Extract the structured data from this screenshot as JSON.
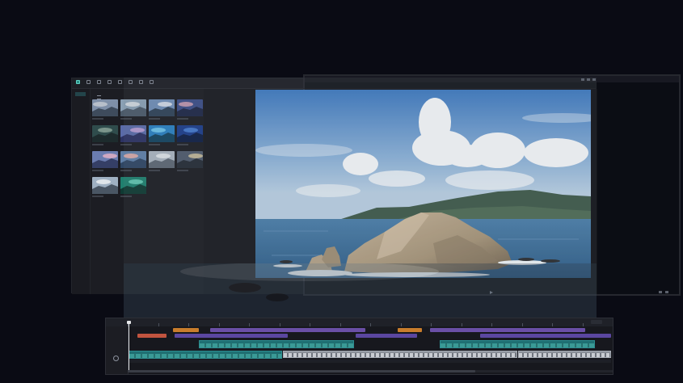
{
  "app": {
    "accent": "#5fd3c5",
    "background": "#0a0b14"
  },
  "editor": {
    "toolbar": [
      {
        "name": "media",
        "icon": "media-icon",
        "active": true
      },
      {
        "name": "audio",
        "icon": "audio-icon"
      },
      {
        "name": "text",
        "icon": "text-icon"
      },
      {
        "name": "stickers",
        "icon": "sticker-icon"
      },
      {
        "name": "effects",
        "icon": "effects-icon"
      },
      {
        "name": "transitions",
        "icon": "transition-icon"
      },
      {
        "name": "filters",
        "icon": "filter-icon"
      },
      {
        "name": "adjust",
        "icon": "adjust-icon"
      }
    ],
    "media_thumbnails": [
      {
        "palette": [
          "#7e8fa8",
          "#c6cbd2",
          "#3e4b5c"
        ]
      },
      {
        "palette": [
          "#8aa0b4",
          "#dfe3e7",
          "#4b5a69"
        ]
      },
      {
        "palette": [
          "#6f8db5",
          "#e6e9ee",
          "#2f4257"
        ]
      },
      {
        "palette": [
          "#3c4d86",
          "#d9a6b5",
          "#1f2747"
        ]
      },
      {
        "palette": [
          "#2f4c4c",
          "#8fa89b",
          "#1d2b2d"
        ]
      },
      {
        "palette": [
          "#5a6aa8",
          "#c7a6d9",
          "#2c3263"
        ]
      },
      {
        "palette": [
          "#2a7fc0",
          "#7ad0f0",
          "#14435f"
        ]
      },
      {
        "palette": [
          "#1c3d8a",
          "#4d86d8",
          "#0f1f45"
        ]
      },
      {
        "palette": [
          "#6b7db0",
          "#e9b3c7",
          "#353f66"
        ]
      },
      {
        "palette": [
          "#5f7fa7",
          "#f1b1a8",
          "#2f4664"
        ]
      },
      {
        "palette": [
          "#aab4bf",
          "#e7ebef",
          "#5d6773"
        ]
      },
      {
        "palette": [
          "#4e5a6b",
          "#d7c7a1",
          "#252c36"
        ]
      },
      {
        "palette": [
          "#9fb0c2",
          "#f0f2f4",
          "#4a5664"
        ]
      },
      {
        "palette": [
          "#1f7f6e",
          "#6fd3bd",
          "#0f3a33"
        ]
      }
    ]
  },
  "timeline": {
    "ticks": 16,
    "playhead_fraction": 0.0
  }
}
